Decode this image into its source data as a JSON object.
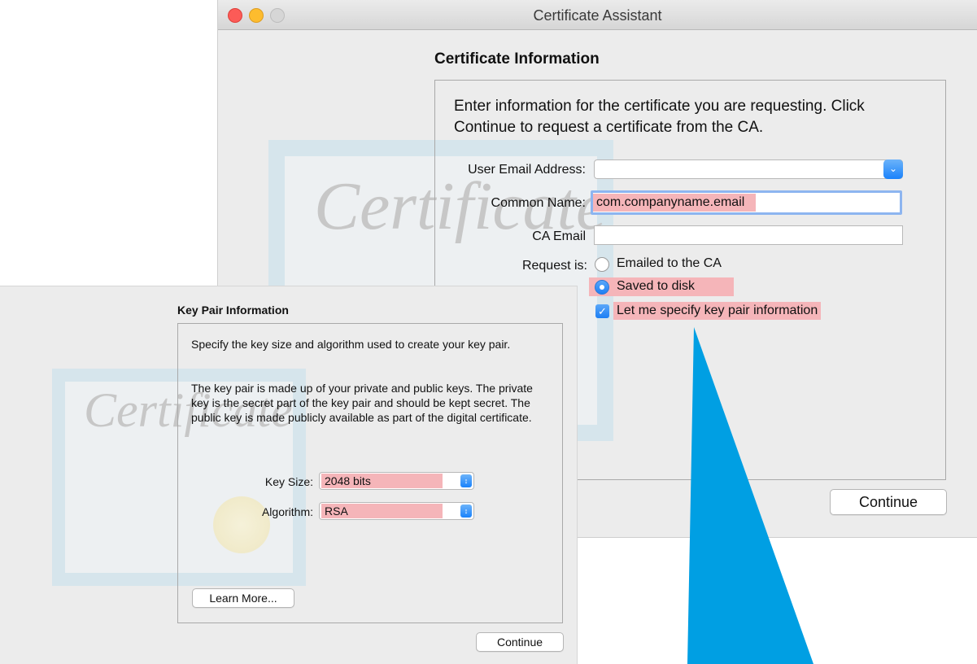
{
  "certificate_assistant": {
    "window_title": "Certificate Assistant",
    "section_title": "Certificate Information",
    "intro": "Enter information for the certificate you are requesting. Click Continue to request a certificate from the CA.",
    "watermark": "Certificate",
    "fields": {
      "user_email_label": "User Email Address:",
      "user_email_value": "",
      "common_name_label": "Common Name:",
      "common_name_value": "com.companyname.email",
      "ca_email_label": "CA Email",
      "ca_email_value": "",
      "request_is_label": "Request is:"
    },
    "request_options": [
      {
        "label": "Emailed to the CA",
        "selected": false
      },
      {
        "label": "Saved to disk",
        "selected": true
      }
    ],
    "checkbox": {
      "label": "Let me specify key pair information",
      "checked": true
    },
    "continue_label": "Continue"
  },
  "key_pair": {
    "section_title": "Key Pair Information",
    "paragraph1": "Specify the key size and algorithm used to create your key pair.",
    "paragraph2": "The key pair is made up of your private and public keys. The private key is the secret part of the key pair and should be kept secret. The public key is made publicly available as part of the digital certificate.",
    "watermark": "Certificate",
    "key_size_label": "Key Size:",
    "key_size_value": "2048 bits",
    "algorithm_label": "Algorithm:",
    "algorithm_value": "RSA",
    "learn_more_label": "Learn More...",
    "continue_label": "Continue"
  },
  "colors": {
    "highlight": "#f5b5b9",
    "accent_blue": "#1a82fb",
    "pointer_blue": "#009fe3"
  }
}
